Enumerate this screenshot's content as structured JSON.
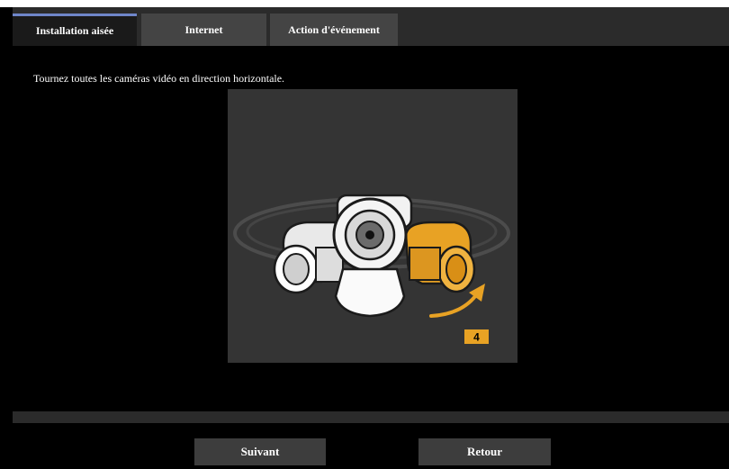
{
  "tabs": [
    {
      "label": "Installation aisée",
      "active": true
    },
    {
      "label": "Internet",
      "active": false
    },
    {
      "label": "Action d'événement",
      "active": false
    }
  ],
  "main": {
    "instruction": "Tournez toutes les caméras vidéo en direction horizontale.",
    "step_badge": "4",
    "illustration_icon": "camera-rotation-illustration"
  },
  "buttons": {
    "next_label": "Suivant",
    "back_label": "Retour"
  },
  "colors": {
    "accent": "#6f86c9",
    "highlight": "#e8a224",
    "panel": "#343434"
  }
}
